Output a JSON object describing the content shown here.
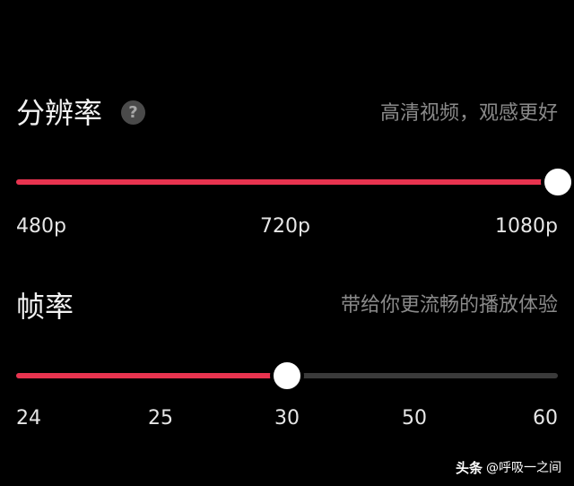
{
  "resolution": {
    "title": "分辨率",
    "help_icon": "question-circle-icon",
    "description": "高清视频，观感更好",
    "ticks": [
      "480p",
      "720p",
      "1080p"
    ],
    "selected": "1080p",
    "level": 1.0
  },
  "framerate": {
    "title": "帧率",
    "description": "带给你更流畅的播放体验",
    "ticks": [
      "24",
      "25",
      "30",
      "50",
      "60"
    ],
    "selected": "30",
    "level": 0.5
  },
  "watermark": {
    "brand": "头条",
    "handle": "@呼吸一之间"
  },
  "colors": {
    "accent": "#e8334f",
    "track": "#3a3a3a",
    "background": "#000000"
  }
}
